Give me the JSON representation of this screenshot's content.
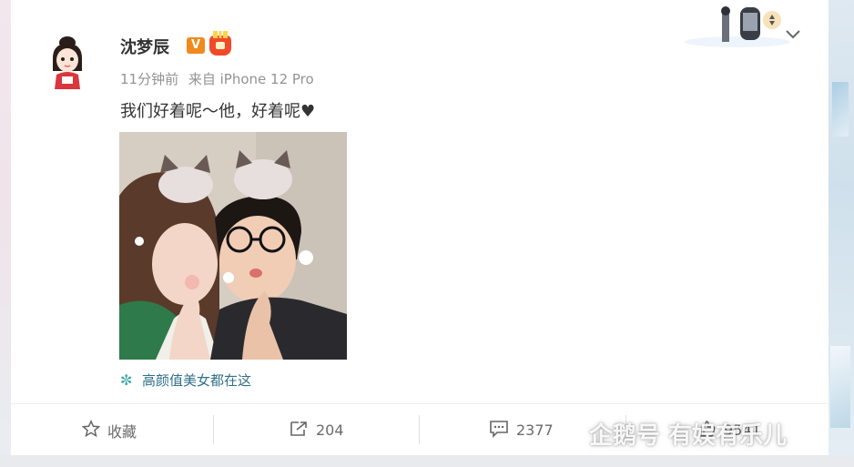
{
  "post": {
    "author": "沈梦辰",
    "verified_badge": "V",
    "time": "11分钟前",
    "source": "来自 iPhone 12 Pro",
    "text": "我们好着呢～他，好着呢♥",
    "topic": "高颜值美女都在这"
  },
  "actions": {
    "favorite_label": "收藏",
    "repost_count": "204",
    "comment_count": "2377",
    "like_count": "9541"
  },
  "watermark": {
    "text": "企鹅号 有娱有乐儿"
  },
  "colors": {
    "vip_orange": "#f08a1c",
    "topic_blue": "#2f6f8a",
    "muted_gray": "#939393"
  },
  "icons": {
    "favorite": "star-icon",
    "repost": "repost-icon",
    "comment": "comment-icon",
    "like": "thumb-up-icon",
    "menu": "chevron-down-icon",
    "topic": "topic-icon"
  }
}
